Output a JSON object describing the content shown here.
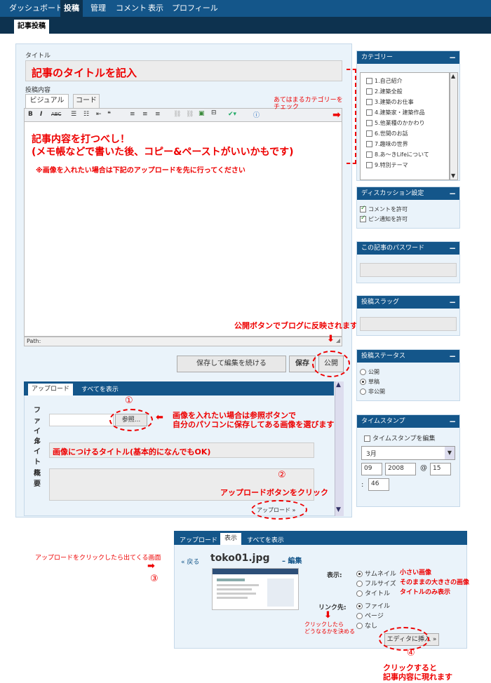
{
  "topnav": {
    "items": [
      "ダッシュボード",
      "投稿",
      "管理",
      "コメント",
      "表示",
      "プロフィール"
    ]
  },
  "subnav": {
    "current": "記事投稿"
  },
  "editor": {
    "title_label": "タイトル",
    "title_value": "記事のタイトルを記入",
    "content_label": "投稿内容",
    "tab_visual": "ビジュアル",
    "tab_code": "コード",
    "content_line1": "記事内容を打つべし！",
    "content_line2": "(メモ帳などで書いた後、コピー&ペーストがいいかもです)",
    "content_note": "※画像を入れたい場合は下記のアップロードを先に行ってください",
    "path_label": "Path:"
  },
  "annotations": {
    "category_hint": "あてはまるカテゴリーを\nチェック",
    "publish_hint": "公開ボタンでブログに反映されます",
    "browse_hint_1": "画像を入れたい場合は参照ボタンで",
    "browse_hint_2": "自分のパソコンに保存してある画像を選びます",
    "image_title_hint": "画像につけるタイトル(基本的になんでもOK)",
    "upload_hint": "アップロードボタンをクリック",
    "after_upload_hint": "アップロードをクリックしたら出てくる画面",
    "size_small": "小さい画像",
    "size_full": "そのままの大きさの画像",
    "size_title": "タイトルのみ表示",
    "link_hint_1": "クリックしたら",
    "link_hint_2": "どうなるかを決める",
    "insert_hint_1": "クリックすると",
    "insert_hint_2": "記事内容に現れます",
    "num1": "①",
    "num2": "②",
    "num3": "③",
    "num4": "④"
  },
  "buttons": {
    "save_continue": "保存して編集を続ける",
    "save": "保存",
    "publish": "公開"
  },
  "upload": {
    "tab_upload": "アップロード",
    "tab_all": "すべてを表示",
    "file_label": "ファイル",
    "title_label": "タイトル",
    "desc_label": "概要",
    "browse": "参照...",
    "upload_btn": "アップロード »"
  },
  "categories": {
    "header": "カテゴリー",
    "items": [
      "1.自己紹介",
      "2.建築全般",
      "3.建築のお仕事",
      "4.建築家・建築作品",
      "5.他業種のかかわり",
      "6.世間のお話",
      "7.趣味の世界",
      "8.あ〜きLifeについて",
      "9.特別テーマ"
    ]
  },
  "discussion": {
    "header": "ディスカッション設定",
    "allow_comments": "コメントを許可",
    "allow_pings": "ピン通知を許可"
  },
  "password": {
    "header": "この記事のパスワード"
  },
  "slug": {
    "header": "投稿スラッグ"
  },
  "status": {
    "header": "投稿ステータス",
    "options": [
      "公開",
      "草稿",
      "非公開"
    ],
    "selected": "草稿"
  },
  "timestamp": {
    "header": "タイムスタンプ",
    "edit_label": "タイムスタンプを編集",
    "month": "3月",
    "day": "09",
    "year": "2008",
    "at": "@",
    "hour": "15",
    "colon": ":",
    "minute": "46"
  },
  "result": {
    "tab_upload": "アップロード",
    "tab_show": "表示",
    "tab_all": "すべてを表示",
    "back": "« 戻る",
    "filename": "toko01.jpg",
    "edit": "– 編集",
    "show_label": "表示:",
    "show_options": [
      "サムネイル",
      "フルサイズ",
      "タイトル"
    ],
    "link_label": "リンク先:",
    "link_options": [
      "ファイル",
      "ページ",
      "なし"
    ],
    "insert_btn": "エディタに挿入 »"
  },
  "colors": {
    "accent": "#14568a",
    "annotation": "#ee0000"
  }
}
